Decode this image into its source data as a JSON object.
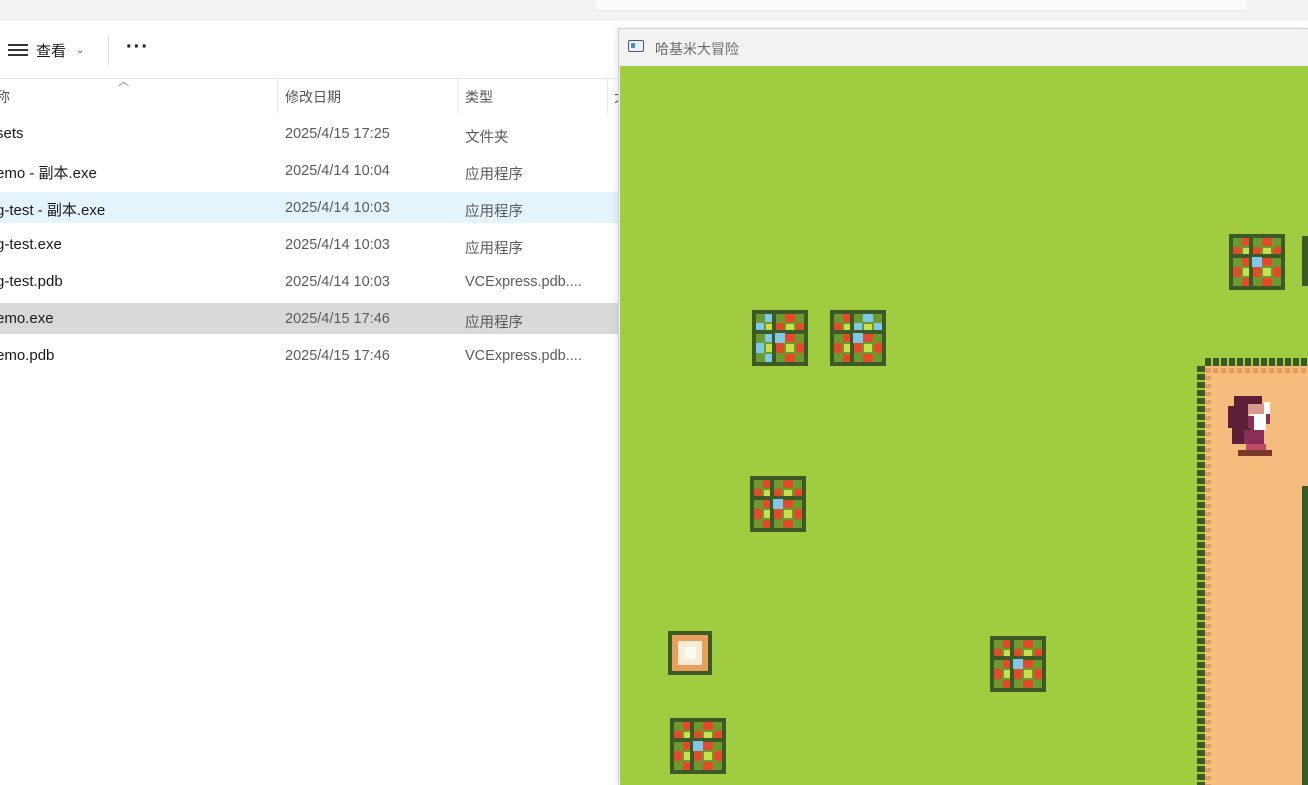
{
  "explorer": {
    "toolbar": {
      "view_label": "查看",
      "view_chevron": "⌄",
      "more_label": "···"
    },
    "columns": {
      "name": "称",
      "modified": "修改日期",
      "type": "类型",
      "size": "大"
    },
    "files": [
      {
        "name": "sets",
        "modified": "2025/4/15 17:25",
        "type": "文件夹",
        "state": "normal"
      },
      {
        "name": "emo - 副本.exe",
        "modified": "2025/4/14 10:04",
        "type": "应用程序",
        "state": "normal"
      },
      {
        "name": "g-test - 副本.exe",
        "modified": "2025/4/14 10:03",
        "type": "应用程序",
        "state": "hover"
      },
      {
        "name": "g-test.exe",
        "modified": "2025/4/14 10:03",
        "type": "应用程序",
        "state": "normal"
      },
      {
        "name": "g-test.pdb",
        "modified": "2025/4/14 10:03",
        "type": "VCExpress.pdb....",
        "state": "normal"
      },
      {
        "name": "emo.exe",
        "modified": "2025/4/15 17:46",
        "type": "应用程序",
        "state": "selected"
      },
      {
        "name": "emo.pdb",
        "modified": "2025/4/15 17:46",
        "type": "VCExpress.pdb....",
        "state": "normal"
      }
    ]
  },
  "game_window": {
    "title": "哈基米大冒险",
    "colors": {
      "grass": "#a0cc3f",
      "bush_dark": "#3c5a26",
      "bush_mid": "#6d9a2f",
      "flower_red": "#e24a2a",
      "flower_blue": "#7fc9e8",
      "flower_center": "#c8e04a",
      "path": "#f4bd7e",
      "path_edge": "#e9995b",
      "hair": "#5b1f38",
      "dress": "#8a2f57"
    },
    "scene": {
      "flowers": [
        {
          "kind": "red-blue-cluster"
        },
        {
          "kind": "blue-red-cluster"
        },
        {
          "kind": "red-blue-cluster"
        },
        {
          "kind": "white-bloom"
        },
        {
          "kind": "red-blue-cluster"
        },
        {
          "kind": "red-cluster"
        },
        {
          "kind": "red-blue-cluster"
        },
        {
          "kind": "partial"
        }
      ],
      "character": "girl-sprite",
      "terrain": "sand-path"
    }
  }
}
